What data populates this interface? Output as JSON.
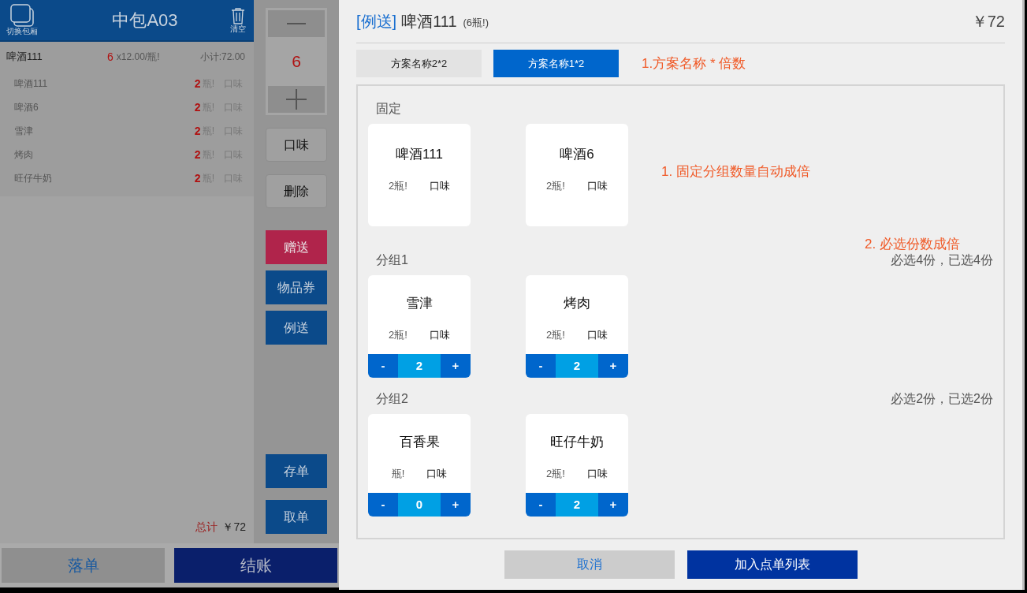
{
  "room_bar": {
    "switch_label": "切换包厢",
    "title": "中包A03",
    "clear_label": "清空"
  },
  "order": {
    "name": "啤酒111",
    "qty": "6",
    "unit_price": "x12.00/瓶!",
    "subtotal": "小计:72.00",
    "items": [
      {
        "name": "啤酒111",
        "qty": "2",
        "unit": "瓶!",
        "taste": "口味"
      },
      {
        "name": "啤酒6",
        "qty": "2",
        "unit": "瓶!",
        "taste": "口味"
      },
      {
        "name": "雪津",
        "qty": "2",
        "unit": "瓶!",
        "taste": "口味"
      },
      {
        "name": "烤肉",
        "qty": "2",
        "unit": "瓶!",
        "taste": "口味"
      },
      {
        "name": "旺仔牛奶",
        "qty": "2",
        "unit": "瓶!",
        "taste": "口味"
      }
    ]
  },
  "total": {
    "label": "总计",
    "value": "￥72"
  },
  "quantity": {
    "value": "6"
  },
  "side_buttons": [
    {
      "label": "口味",
      "kind": "light"
    },
    {
      "label": "删除",
      "kind": "light"
    },
    {
      "label": "赠送",
      "kind": "red"
    },
    {
      "label": "物品券",
      "kind": "blue"
    },
    {
      "label": "例送",
      "kind": "blue"
    }
  ],
  "lower_buttons": [
    {
      "label": "存单",
      "kind": "blue"
    },
    {
      "label": "取单",
      "kind": "blue"
    }
  ],
  "bottom_buttons": [
    {
      "label": "落单",
      "kind": "light"
    },
    {
      "label": "结账",
      "kind": "dark"
    }
  ],
  "dialog": {
    "tag": "[例送]",
    "title": "啤酒111",
    "count": "(6瓶!)",
    "price": "￥72",
    "tabs": [
      {
        "label": "方案名称2*2",
        "selected": false
      },
      {
        "label": "方案名称1*2",
        "selected": true
      }
    ],
    "tab_note": "1.方案名称 * 倍数",
    "sections": [
      {
        "title": "固定",
        "side_note": "1. 固定分组数量自动成倍",
        "items": [
          {
            "name": "啤酒111",
            "unit": "2瓶!",
            "taste": "口味"
          },
          {
            "name": "啤酒6",
            "unit": "2瓶!",
            "taste": "口味"
          }
        ]
      },
      {
        "title": "分组1",
        "top_note": "2. 必选份数成倍",
        "rule": "必选4份，已选4份",
        "items": [
          {
            "name": "雪津",
            "unit": "2瓶!",
            "taste": "口味",
            "stepper": {
              "minus": "-",
              "value": "2",
              "plus": "+"
            }
          },
          {
            "name": "烤肉",
            "unit": "2瓶!",
            "taste": "口味",
            "stepper": {
              "minus": "-",
              "value": "2",
              "plus": "+"
            }
          }
        ]
      },
      {
        "title": "分组2",
        "rule": "必选2份，已选2份",
        "items": [
          {
            "name": "百香果",
            "unit": "瓶!",
            "taste": "口味",
            "stepper": {
              "minus": "-",
              "value": "0",
              "plus": "+"
            }
          },
          {
            "name": "旺仔牛奶",
            "unit": "2瓶!",
            "taste": "口味",
            "stepper": {
              "minus": "-",
              "value": "2",
              "plus": "+"
            }
          }
        ]
      }
    ],
    "buttons": [
      {
        "label": "取消",
        "kind": "secondary"
      },
      {
        "label": "加入点单列表",
        "kind": "primary"
      }
    ]
  }
}
